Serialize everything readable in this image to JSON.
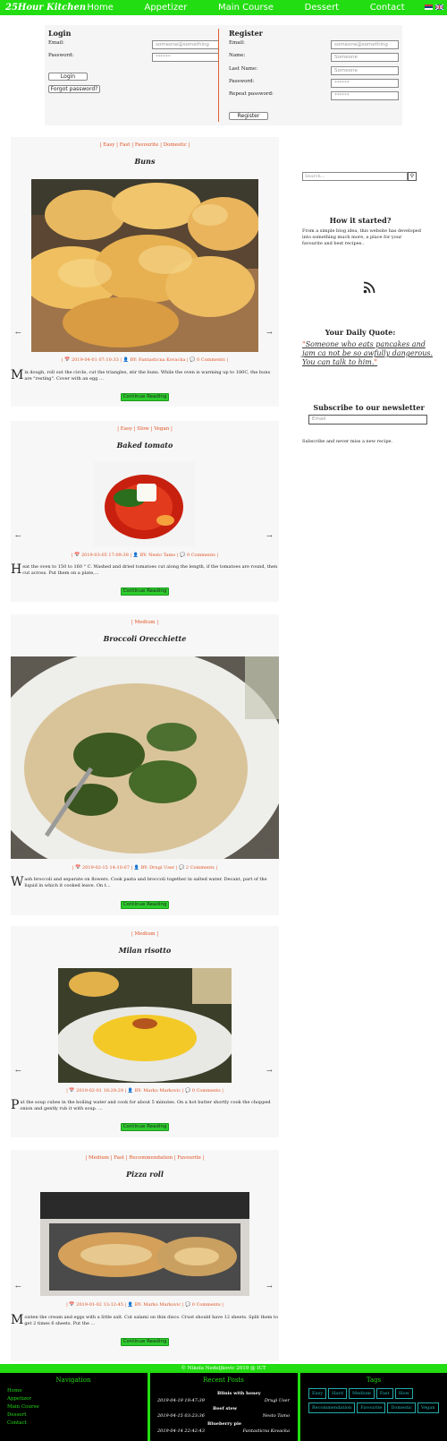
{
  "nav": {
    "logo": "25Hour Kitchen",
    "links": [
      "Home",
      "Appetizer",
      "Main Course",
      "Dessert",
      "Contact"
    ]
  },
  "login": {
    "title": "Login",
    "email_label": "Email:",
    "email_placeholder": "someone@something",
    "password_label": "Password:",
    "password_value": "******",
    "login_button": "Login",
    "forgot_button": "Forgot password?"
  },
  "register": {
    "title": "Register",
    "email_label": "Email:",
    "email_placeholder": "someone@something",
    "name_label": "Name:",
    "name_placeholder": "Someone",
    "lastname_label": "Last Name:",
    "lastname_placeholder": "Someone",
    "password_label": "Password:",
    "password_value": "******",
    "repeat_label": "Repeat password:",
    "repeat_value": "******",
    "register_button": "Register"
  },
  "posts": [
    {
      "tags": "| Easy | Fast | Favourite | Domestic |",
      "title": "Buns",
      "meta": "| 📅 2019-04-01 07:10:33 | 👤 BY: Fantasticna Kovacka | 💬 0 Comments |",
      "cap": "M",
      "excerpt": "ix dough, roll out the circle, cut the triangles, stir the buns. While the oven is warming up to 180C, the buns are \"resting\". Cover with an egg ...",
      "button": "Continue Reading"
    },
    {
      "tags": "| Easy | Slow | Vegan |",
      "title": "Baked tomato",
      "meta": "| 📅 2019-03-05 17:09:38 | 👤 BY: Nesto Tamo | 💬 0 Comments |",
      "cap": "H",
      "excerpt": "eat the oven to 150 to 160 ° C. Washed and dried tomatoes cut along the length, if the tomatoes are round, then cut across. Put them on a plate,...",
      "button": "Continue Reading"
    },
    {
      "tags": "| Medium |",
      "title": "Broccoli Orecchiette",
      "meta": "| 📅 2019-02-15 14:10:07 | 👤 BY: Drugi User | 💬 2 Comments |",
      "cap": "W",
      "excerpt": "ash broccoli and separate on flowers. Cook pasta and broccoli together in salted water. Decant, part of the liquid in which it cooked leave. On t...",
      "button": "Continue Reading"
    },
    {
      "tags": "| Medium |",
      "title": "Milan risotto",
      "meta": "| 📅 2019-02-01 18:29:29 | 👤 BY: Marko Markovic | 💬 0 Comments |",
      "cap": "P",
      "excerpt": "ut the soup cubes in the boiling water and cook for about 5 minutes. On a hot butter shortly cook the chopped onion and gently rub it with soup. ...",
      "button": "Continue Reading"
    },
    {
      "tags": "| Medium | Fast | Recommendation | Favourite |",
      "title": "Pizza roll",
      "meta": "| 📅 2019-01-02 13:12:45 | 👤 BY: Marko Markovic | 💬 0 Comments |",
      "cap": "M",
      "excerpt": "oisten the cream and eggs with a little salt. Cut salami on thin discs. Crust should have 12 sheets. Split them to get 2 times 6 sheets. Put the ...",
      "button": "Continue Reading"
    }
  ],
  "sidebar": {
    "search_placeholder": "Search...",
    "how_title": "How it started?",
    "how_text": "From a simple blog idea, this website has developed into something much more, a place for your favourite and best recipes..",
    "quote_title": "Your Daily Quote:",
    "quote_text": "Someone who eats pancakes and jam ca not be so awfully dangerous. You can talk to him.",
    "newsletter_title": "Subscribe to our newsletter",
    "newsletter_placeholder": "Email",
    "newsletter_text": "Subscribe and never miss a new recipe."
  },
  "footer": {
    "copyright": "© Nikola Nedeljkovic 2019 @ ICT",
    "nav_title": "Navigation",
    "nav_links": [
      "Home",
      "Appetizer",
      "Main Course",
      "Dessert",
      "Contact"
    ],
    "recent_title": "Recent Posts",
    "recent": [
      {
        "date": "2019-04-19 19:47:39",
        "title": "Blinis with honey",
        "author": "Drugi User"
      },
      {
        "date": "2019-04-15 03:23:36",
        "title": "Beef stew",
        "author": "Nesto Tamo"
      },
      {
        "date": "2019-04-14 22:42:43",
        "title": "Blueberry pie",
        "author": "Fantasticna Kovacka"
      }
    ],
    "tags_title": "Tags",
    "tags": [
      "Easy",
      "Hard",
      "Medium",
      "Fast",
      "Slow",
      "Recommendation",
      "Favourite",
      "Domestic",
      "Vegan"
    ]
  },
  "colors": {
    "brand_green": "#22dd11",
    "accent_orange": "#e05020",
    "footer_bg": "#000000"
  }
}
